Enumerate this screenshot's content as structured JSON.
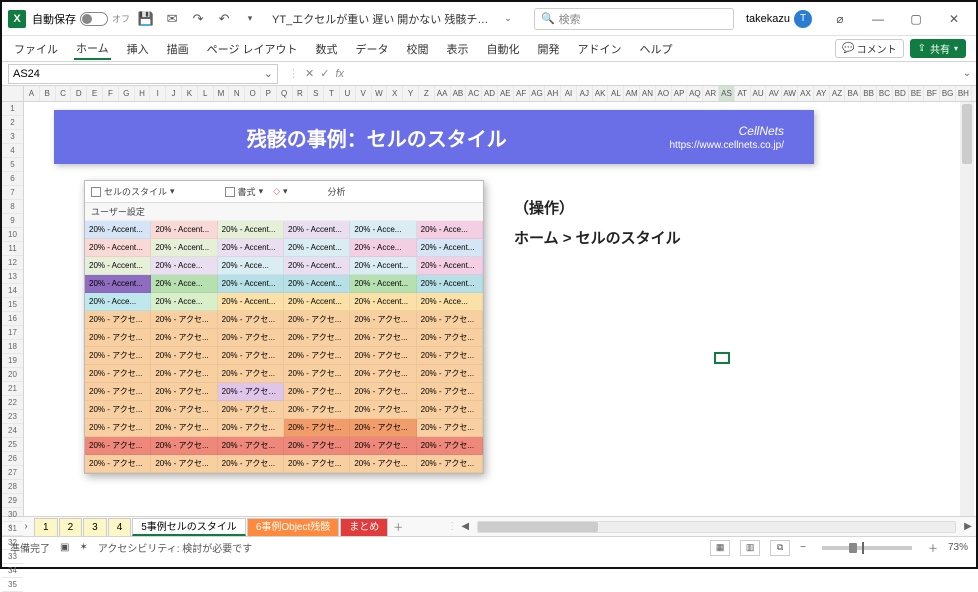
{
  "titlebar": {
    "autosave_label": "自動保存",
    "autosave_state": "オフ",
    "filename": "YT_エクセルが重い 遅い 開かない 残骸チェックで原因究明…",
    "search_placeholder": "検索",
    "username": "takekazu",
    "avatar_initial": "T"
  },
  "ribbon": {
    "tabs": [
      "ファイル",
      "ホーム",
      "挿入",
      "描画",
      "ページ レイアウト",
      "数式",
      "データ",
      "校閲",
      "表示",
      "自動化",
      "開発",
      "アドイン",
      "ヘルプ"
    ],
    "comment": "コメント",
    "share": "共有"
  },
  "formula_bar": {
    "namebox": "AS24",
    "value": ""
  },
  "columns": [
    "A",
    "B",
    "C",
    "D",
    "E",
    "F",
    "G",
    "H",
    "I",
    "J",
    "K",
    "L",
    "M",
    "N",
    "O",
    "P",
    "Q",
    "R",
    "S",
    "T",
    "U",
    "V",
    "W",
    "X",
    "Y",
    "Z",
    "AA",
    "AB",
    "AC",
    "AD",
    "AE",
    "AF",
    "AG",
    "AH",
    "AI",
    "AJ",
    "AK",
    "AL",
    "AM",
    "AN",
    "AO",
    "AP",
    "AQ",
    "AR",
    "AS",
    "AT",
    "AU",
    "AV",
    "AW",
    "AX",
    "AY",
    "AZ",
    "BA",
    "BB",
    "BC",
    "BD",
    "BE",
    "BF",
    "BG",
    "BH"
  ],
  "sel_col_index": 44,
  "rows_count": 35,
  "banner": {
    "title": "残骸の事例：セルのスタイル",
    "logo": "CellNets",
    "url": "https://www.cellnets.co.jp/"
  },
  "gallery": {
    "toolbar": {
      "styles": "セルのスタイル",
      "format": "書式",
      "analysis": "分析"
    },
    "section_user": "ユーザー設定",
    "rows": [
      [
        {
          "t": "20% - Accent...",
          "c": "#d6e5f5"
        },
        {
          "t": "20% - Accent...",
          "c": "#f9d9d6"
        },
        {
          "t": "20% - Accent...",
          "c": "#e6f0d9"
        },
        {
          "t": "20% - Accent...",
          "c": "#e9dff1"
        },
        {
          "t": "20% - Acce...",
          "c": "#d9edf3"
        },
        {
          "t": "20% - Acce...",
          "c": "#f4cfe4"
        }
      ],
      [
        {
          "t": "20% - Accent...",
          "c": "#f9d9d6"
        },
        {
          "t": "20% - Accent...",
          "c": "#e6f0d9"
        },
        {
          "t": "20% - Accent...",
          "c": "#e9dff1"
        },
        {
          "t": "20% - Accent...",
          "c": "#d9edf3"
        },
        {
          "t": "20% - Acce...",
          "c": "#f4cfe4"
        },
        {
          "t": "20% - Accent...",
          "c": "#d6e5f5"
        }
      ],
      [
        {
          "t": "20% - Accent...",
          "c": "#e6f0d9"
        },
        {
          "t": "20% - Acce...",
          "c": "#e9dff1"
        },
        {
          "t": "20% - Acce...",
          "c": "#d9edf3"
        },
        {
          "t": "20% - Accent...",
          "c": "#e9dff1"
        },
        {
          "t": "20% - Accent...",
          "c": "#d9edf3"
        },
        {
          "t": "20% - Accent...",
          "c": "#f4cfe4"
        }
      ],
      [
        {
          "t": "20% - Accent...",
          "c": "#8e6cc0"
        },
        {
          "t": "20% - Acce...",
          "c": "#b7e0b0"
        },
        {
          "t": "20% - Accent...",
          "c": "#b7e0e6"
        },
        {
          "t": "20% - Accent...",
          "c": "#b7e0e6"
        },
        {
          "t": "20% - Accent...",
          "c": "#b7e0b0"
        },
        {
          "t": "20% - Accent...",
          "c": "#b7e0e6"
        }
      ],
      [
        {
          "t": "20% - Acce...",
          "c": "#bfe8ee"
        },
        {
          "t": "20% - Acce...",
          "c": "#d8efc9"
        },
        {
          "t": "20% - Accent...",
          "c": "#fbe1a7"
        },
        {
          "t": "20% - Accent...",
          "c": "#fbe1a7"
        },
        {
          "t": "20% - Accent...",
          "c": "#fbe1a7"
        },
        {
          "t": "20% - Acce...",
          "c": "#fbe1a7"
        }
      ],
      [
        {
          "t": "20% - アクセ...",
          "c": "#f8cfa0"
        },
        {
          "t": "20% - アクセ...",
          "c": "#f8cfa0"
        },
        {
          "t": "20% - アクセ...",
          "c": "#f8cfa0"
        },
        {
          "t": "20% - アクセ...",
          "c": "#f8cfa0"
        },
        {
          "t": "20% - アクセ...",
          "c": "#f8cfa0"
        },
        {
          "t": "20% - アクセ...",
          "c": "#f8cfa0"
        }
      ],
      [
        {
          "t": "20% - アクセ...",
          "c": "#f8cfa0"
        },
        {
          "t": "20% - アクセ...",
          "c": "#f8cfa0"
        },
        {
          "t": "20% - アクセ...",
          "c": "#f8cfa0"
        },
        {
          "t": "20% - アクセ...",
          "c": "#f8cfa0"
        },
        {
          "t": "20% - アクセ...",
          "c": "#f8cfa0"
        },
        {
          "t": "20% - アクセ...",
          "c": "#f8cfa0"
        }
      ],
      [
        {
          "t": "20% - アクセ...",
          "c": "#f8cfa0"
        },
        {
          "t": "20% - アクセ...",
          "c": "#f8cfa0"
        },
        {
          "t": "20% - アクセ...",
          "c": "#f8cfa0"
        },
        {
          "t": "20% - アクセ...",
          "c": "#f8cfa0"
        },
        {
          "t": "20% - アクセ...",
          "c": "#f8cfa0"
        },
        {
          "t": "20% - アクセ...",
          "c": "#f8cfa0"
        }
      ],
      [
        {
          "t": "20% - アクセ...",
          "c": "#f8cfa0"
        },
        {
          "t": "20% - アクセ...",
          "c": "#f8cfa0"
        },
        {
          "t": "20% - アクセ...",
          "c": "#f8cfa0"
        },
        {
          "t": "20% - アクセ...",
          "c": "#f8cfa0"
        },
        {
          "t": "20% - アクセ...",
          "c": "#f8cfa0"
        },
        {
          "t": "20% - アクセ...",
          "c": "#f8cfa0"
        }
      ],
      [
        {
          "t": "20% - アクセ...",
          "c": "#f8cfa0"
        },
        {
          "t": "20% - アクセ...",
          "c": "#f8cfa0"
        },
        {
          "t": "20% - アクセン...",
          "c": "#e0c5ea"
        },
        {
          "t": "20% - アクセ...",
          "c": "#f8cfa0"
        },
        {
          "t": "20% - アクセ...",
          "c": "#f8cfa0"
        },
        {
          "t": "20% - アクセ...",
          "c": "#f8cfa0"
        }
      ],
      [
        {
          "t": "20% - アクセ...",
          "c": "#f8cfa0"
        },
        {
          "t": "20% - アクセ...",
          "c": "#f8cfa0"
        },
        {
          "t": "20% - アクセ...",
          "c": "#f8cfa0"
        },
        {
          "t": "20% - アクセ...",
          "c": "#f8cfa0"
        },
        {
          "t": "20% - アクセ...",
          "c": "#f8cfa0"
        },
        {
          "t": "20% - アクセ...",
          "c": "#f8cfa0"
        }
      ],
      [
        {
          "t": "20% - アクセ...",
          "c": "#f8cfa0"
        },
        {
          "t": "20% - アクセ...",
          "c": "#f8cfa0"
        },
        {
          "t": "20% - アクセ...",
          "c": "#f8cfa0"
        },
        {
          "t": "20% - アクセ...",
          "c": "#f19d6b"
        },
        {
          "t": "20% - アクセ...",
          "c": "#f19d6b"
        },
        {
          "t": "20% - アクセ...",
          "c": "#f8cfa0"
        }
      ],
      [
        {
          "t": "20% - アクセ...",
          "c": "#ed887a"
        },
        {
          "t": "20% - アクセ...",
          "c": "#ed887a"
        },
        {
          "t": "20% - アクセ...",
          "c": "#ed887a"
        },
        {
          "t": "20% - アクセ...",
          "c": "#ed887a"
        },
        {
          "t": "20% - アクセ...",
          "c": "#ed887a"
        },
        {
          "t": "20% - アクセ...",
          "c": "#ed887a"
        }
      ],
      [
        {
          "t": "20% - アクセ...",
          "c": "#f8cfa0"
        },
        {
          "t": "20% - アクセ...",
          "c": "#f8cfa0"
        },
        {
          "t": "20% - アクセ...",
          "c": "#f8cfa0"
        },
        {
          "t": "20% - アクセ...",
          "c": "#f8cfa0"
        },
        {
          "t": "20% - アクセ...",
          "c": "#f8cfa0"
        },
        {
          "t": "20% - アクセ...",
          "c": "#f8cfa0"
        }
      ]
    ]
  },
  "operation": {
    "heading": "（操作）",
    "path": "ホーム > セルのスタイル"
  },
  "sheets": {
    "nums": [
      "1",
      "2",
      "3",
      "4"
    ],
    "active": "5事例セルのスタイル",
    "orange": "6事例Object残骸",
    "red": "まとめ"
  },
  "status": {
    "ready": "準備完了",
    "access": "アクセシビリティ: 検討が必要です",
    "zoom": "73%"
  }
}
